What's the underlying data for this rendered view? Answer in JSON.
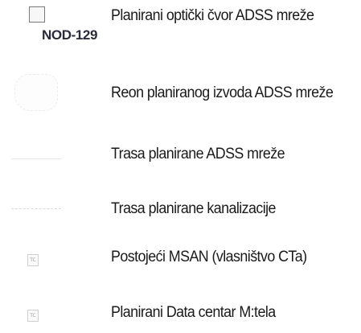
{
  "legend": {
    "items": [
      {
        "icon": "node-square-icon",
        "code": "NOD-129",
        "label": "Planirani optički čvor ADSS mreže"
      },
      {
        "icon": "area-outline-icon",
        "label": "Reon planiranog  izvoda ADSS mreže"
      },
      {
        "icon": "solid-line-icon",
        "label": "Trasa planirane ADSS mreže"
      },
      {
        "icon": "dashed-line-icon",
        "label": "Trasa planirane kanalizacije"
      },
      {
        "icon": "tc-box-icon",
        "icon_text": "TC",
        "label": "Postojeći MSAN (vlasništvo CTa)"
      },
      {
        "icon": "tc-box-icon",
        "icon_text": "TC",
        "label": "Planirani Data centar M:tela"
      }
    ]
  }
}
